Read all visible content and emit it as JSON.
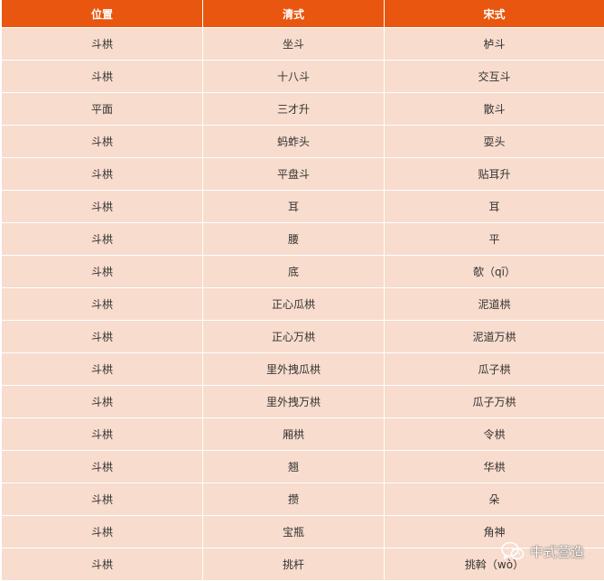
{
  "table": {
    "headers": [
      "位置",
      "清式",
      "宋式"
    ],
    "rows": [
      [
        "斗栱",
        "坐斗",
        "栌斗"
      ],
      [
        "斗栱",
        "十八斗",
        "交互斗"
      ],
      [
        "平面",
        "三才升",
        "散斗"
      ],
      [
        "斗栱",
        "蚂蚱头",
        "耍头"
      ],
      [
        "斗栱",
        "平盘斗",
        "贴耳升"
      ],
      [
        "斗栱",
        "耳",
        "耳"
      ],
      [
        "斗栱",
        "腰",
        "平"
      ],
      [
        "斗栱",
        "底",
        "欹（qī）"
      ],
      [
        "斗栱",
        "正心瓜栱",
        "泥道栱"
      ],
      [
        "斗栱",
        "正心万栱",
        "泥道万栱"
      ],
      [
        "斗栱",
        "里外拽瓜栱",
        "瓜子栱"
      ],
      [
        "斗栱",
        "里外拽万栱",
        "瓜子万栱"
      ],
      [
        "斗栱",
        "厢栱",
        "令栱"
      ],
      [
        "斗栱",
        "翘",
        "华栱"
      ],
      [
        "斗栱",
        "攒",
        "朵"
      ],
      [
        "斗栱",
        "宝瓶",
        "角神"
      ],
      [
        "斗栱",
        "挑杆",
        "挑斡（wò）"
      ]
    ]
  },
  "watermark": {
    "text": "中式营造",
    "icon": "wechat-logo-icon"
  },
  "colors": {
    "header_bg": "#e8560f",
    "row_bg": "#f8dccd"
  }
}
